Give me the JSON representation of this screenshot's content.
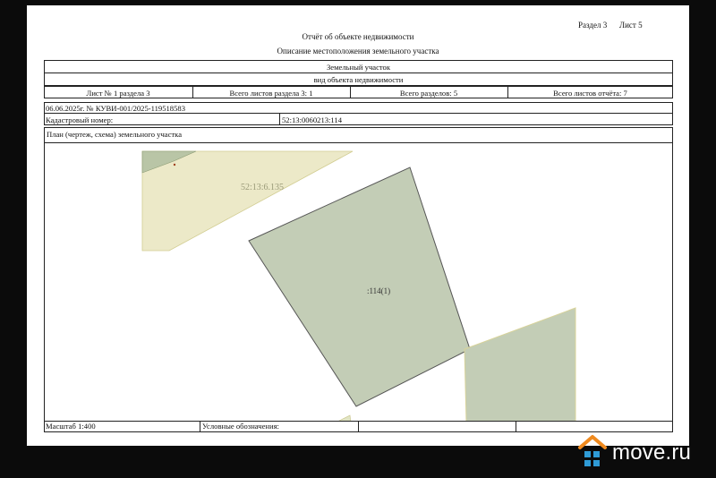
{
  "header": {
    "section": "Раздел 3",
    "sheet": "Лист 5",
    "title": "Отчёт об объекте недвижимости",
    "subtitle": "Описание местоположения земельного участка"
  },
  "table": {
    "object_name": "Земельный участок",
    "object_kind_label": "вид объекта недвижимости",
    "sheet_no": "Лист № 1 раздела 3",
    "total_sheets_section": "Всего листов раздела 3: 1",
    "total_sections": "Всего разделов: 5",
    "total_sheets_report": "Всего листов отчёта: 7",
    "doc_ref": "06.06.2025г. № КУВИ-001/2025-119518583",
    "cadastral_label": "Кадастровый номер:",
    "cadastral_value": "52:13:0060213:114",
    "plan_label": "План (чертеж, схема) земельного участка"
  },
  "map": {
    "neighbor_label": "52:13:6.135",
    "parcel_label": ":114(1)",
    "colors": {
      "neighbor_fill": "#ece9c8",
      "parcel_fill": "#c3cdb6",
      "parcel_stroke": "#555555",
      "corner_fill": "#b9c5a6"
    }
  },
  "footer": {
    "scale": "Масштаб 1:400",
    "legend_label": "Условные обозначения:"
  },
  "watermark": {
    "brand": "move.ru",
    "colors": {
      "house": "#f08a1e",
      "grid": "#2f9bd6"
    }
  }
}
